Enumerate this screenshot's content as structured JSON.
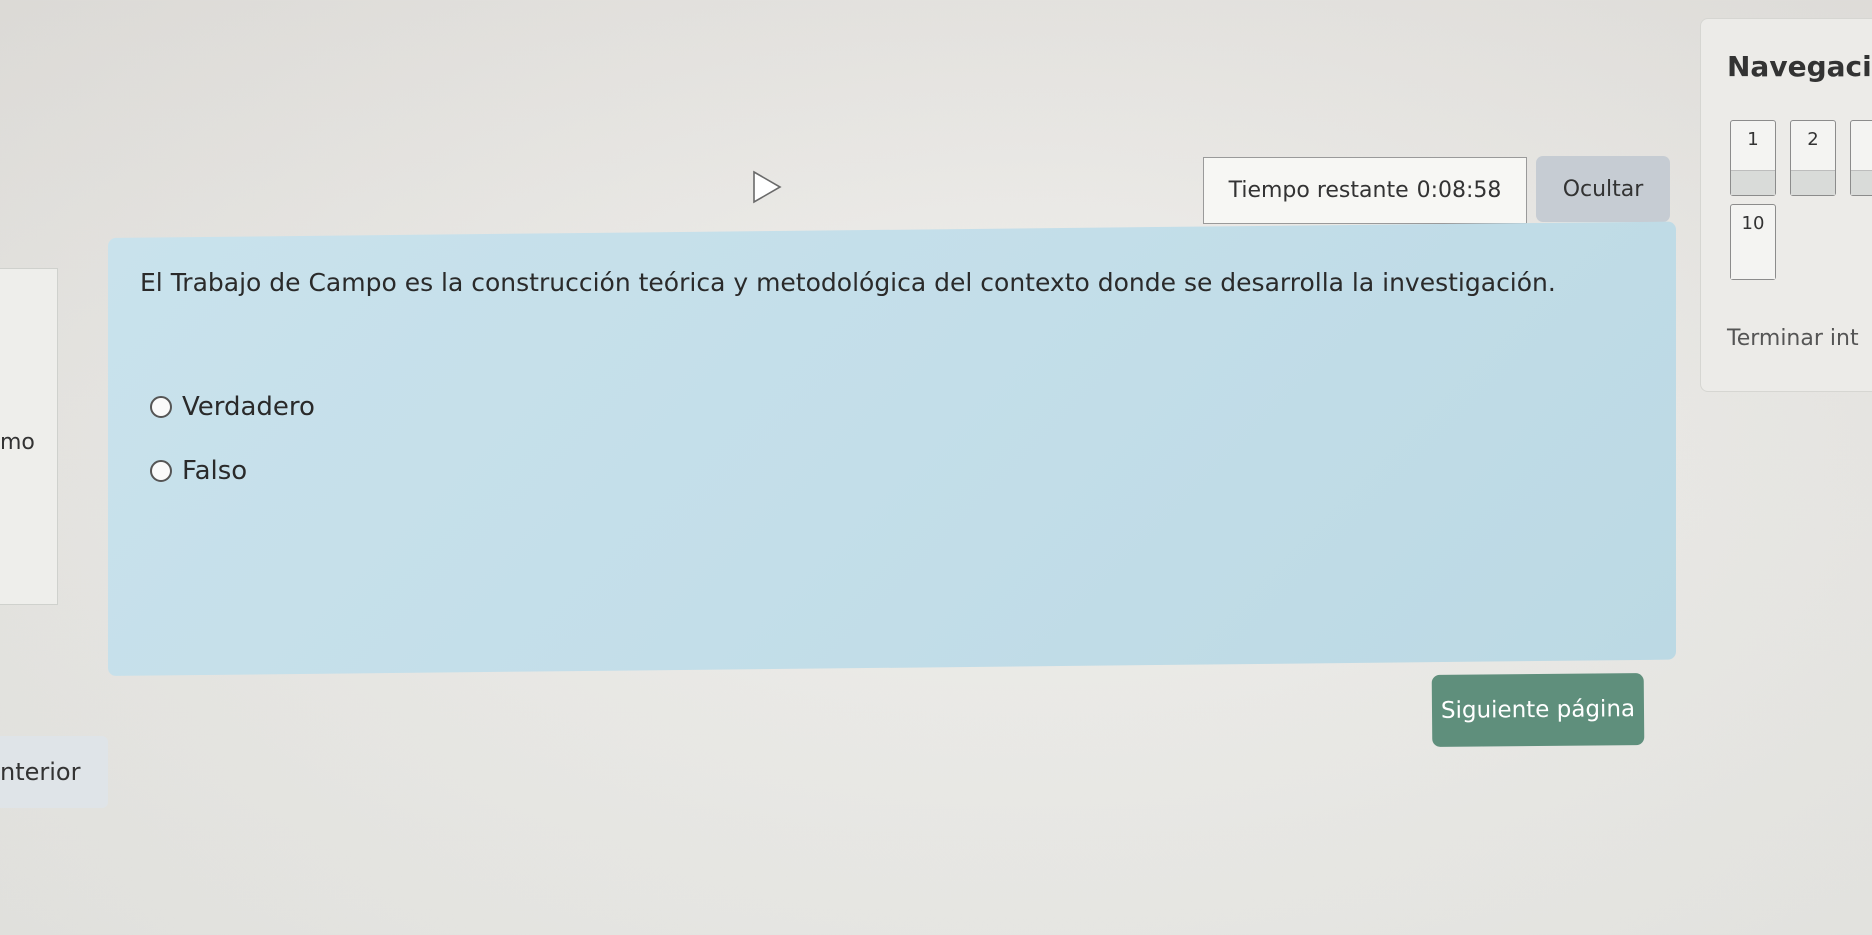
{
  "timer": {
    "label": "Tiempo restante",
    "value": "0:08:58",
    "hide_label": "Ocultar"
  },
  "question": {
    "text": "El Trabajo de Campo es la construcción teórica y metodológica del contexto donde se desarrolla la investigación.",
    "options": [
      {
        "label": "Verdadero",
        "selected": false
      },
      {
        "label": "Falso",
        "selected": false
      }
    ]
  },
  "navigation": {
    "title": "Navegaci",
    "buttons": [
      {
        "label": "1"
      },
      {
        "label": "2"
      },
      {
        "label": ""
      },
      {
        "label": "10"
      }
    ],
    "finish_label": "Terminar int"
  },
  "buttons": {
    "next_label": "Siguiente página",
    "prev_label": "nterior"
  },
  "left_panel": {
    "text": "mo"
  },
  "colors": {
    "question_bg": "#c6e0ea",
    "next_button": "#5f8f7c",
    "hide_button": "#c6ccd3"
  }
}
